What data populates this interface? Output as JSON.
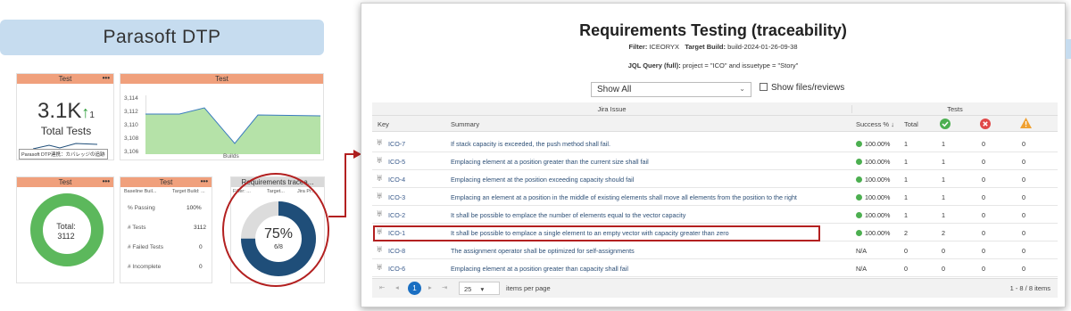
{
  "banner": "Parasoft DTP",
  "w1": {
    "title": "Test",
    "value": "3.1K",
    "arrow": "↑",
    "delta": "1",
    "label": "Total Tests",
    "footer": "Parasoft DTP連携：カバレッジの追跡"
  },
  "w2": {
    "title": "Test",
    "yticks": [
      "3,114",
      "3,112",
      "3,110",
      "3,108",
      "3,106"
    ],
    "xlabel": "Builds"
  },
  "w3": {
    "title": "Test",
    "donut_label": "Total:",
    "donut_value": "3112"
  },
  "w4": {
    "title": "Test",
    "col1": "Baseline Buil...",
    "col2": "Target Build: ...",
    "rows": [
      {
        "label": "% Passing",
        "value": "100%"
      },
      {
        "label": "# Tests",
        "value": "3112"
      },
      {
        "label": "# Failed Tests",
        "value": "0"
      },
      {
        "label": "# Incomplete",
        "value": "0"
      }
    ]
  },
  "w5": {
    "title": "Requirements tracea...",
    "c1": "Filter: ...",
    "c2": "Target...",
    "c3": "Jira Pr...",
    "pct": "75%",
    "fraction": "6/8",
    "fill": 0.75
  },
  "report": {
    "title": "Requirements Testing (traceability)",
    "filter_label": "Filter:",
    "filter_value": "ICEORYX",
    "build_label": "Target Build:",
    "build_value": "build-2024-01-26-09-38",
    "jql_label": "JQL Query (full):",
    "jql_value": "project = \"ICO\" and issuetype = \"Story\"",
    "select_value": "Show All",
    "checkbox_label": "Show files/reviews",
    "group_jira": "Jira Issue",
    "group_tests": "Tests",
    "col_key": "Key",
    "col_summary": "Summary",
    "col_success": "Success %",
    "col_total": "Total",
    "rows": [
      {
        "key": "ICO-7",
        "summary": "If stack capacity is exceeded, the push method shall fail.",
        "success": "100.00%",
        "ok": true,
        "total": "1",
        "passed": "1",
        "failed": "0",
        "warn": "0"
      },
      {
        "key": "ICO-5",
        "summary": "Emplacing element at a position greater than the current size shall fail",
        "success": "100.00%",
        "ok": true,
        "total": "1",
        "passed": "1",
        "failed": "0",
        "warn": "0"
      },
      {
        "key": "ICO-4",
        "summary": "Emplacing element at the position exceeding capacity should fail",
        "success": "100.00%",
        "ok": true,
        "total": "1",
        "passed": "1",
        "failed": "0",
        "warn": "0"
      },
      {
        "key": "ICO-3",
        "summary": "Emplacing an element at a position in the middle of existing elements shall move all elements from the position to the right",
        "success": "100.00%",
        "ok": true,
        "total": "1",
        "passed": "1",
        "failed": "0",
        "warn": "0"
      },
      {
        "key": "ICO-2",
        "summary": "It shall be possible to emplace the number of elements equal to the vector capacity",
        "success": "100.00%",
        "ok": true,
        "total": "1",
        "passed": "1",
        "failed": "0",
        "warn": "0"
      },
      {
        "key": "ICO-1",
        "summary": "It shall be possible to emplace a single element to an empty vector with capacity greater than zero",
        "success": "100.00%",
        "ok": true,
        "total": "2",
        "passed": "2",
        "failed": "0",
        "warn": "0"
      },
      {
        "key": "ICO-8",
        "summary": "The assignment operator shall be optimized for self-assignments",
        "success": "N/A",
        "ok": false,
        "total": "0",
        "passed": "0",
        "failed": "0",
        "warn": "0"
      },
      {
        "key": "ICO-6",
        "summary": "Emplacing element at a position greater than capacity shall fail",
        "success": "N/A",
        "ok": false,
        "total": "0",
        "passed": "0",
        "failed": "0",
        "warn": "0"
      }
    ],
    "page": "1",
    "per_page": "25",
    "per_page_label": "items per page",
    "range": "1 - 8 / 8 items"
  },
  "colors": {
    "accent_orange": "#f0a07c",
    "green": "#4caf50",
    "navy": "#1f4e79",
    "highlight": "#c00000"
  }
}
